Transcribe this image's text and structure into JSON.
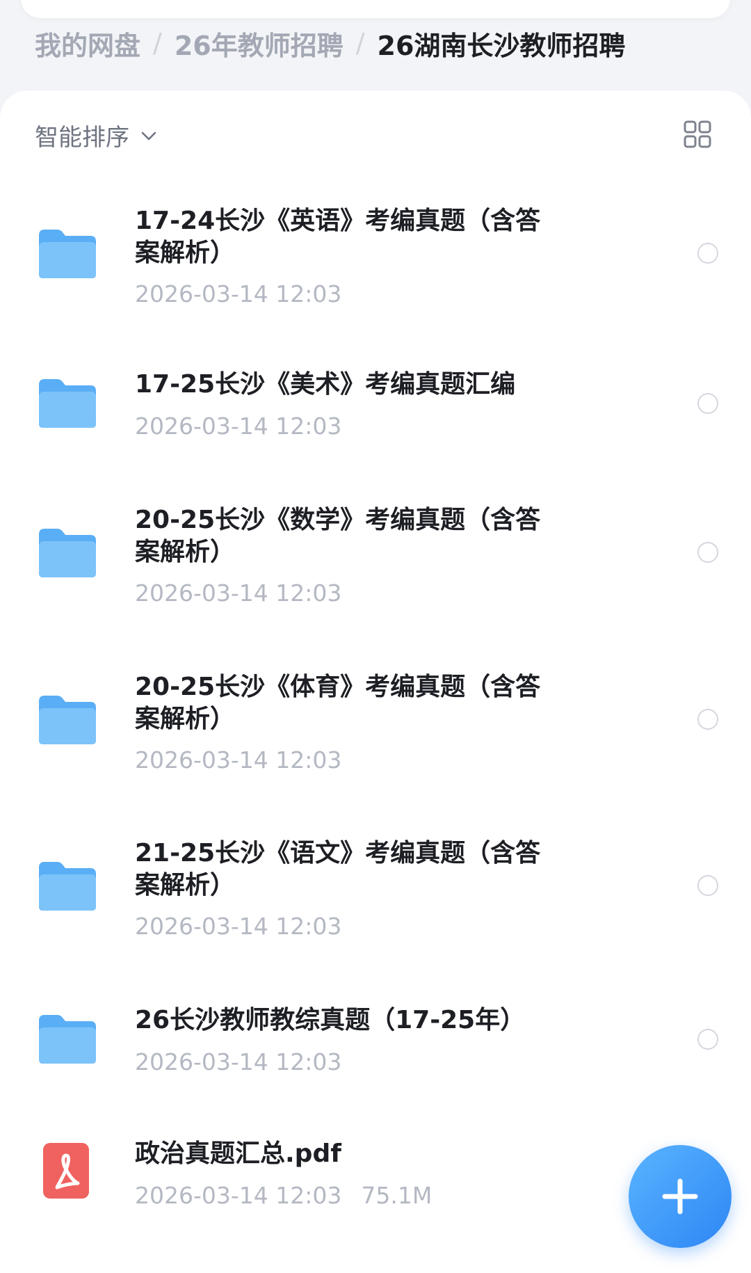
{
  "breadcrumb": [
    {
      "label": "我的网盘"
    },
    {
      "label": "26年教师招聘"
    },
    {
      "label": "26湖南长沙教师招聘"
    }
  ],
  "breadcrumb_separator": "/",
  "toolbar": {
    "sort_label": "智能排序",
    "sort_chevron_icon": "chevron-down-icon",
    "view_toggle_icon": "grid-view-icon"
  },
  "files": [
    {
      "type": "folder",
      "icon": "folder-icon",
      "name": "17-24长沙《英语》考编真题（含答案解析）",
      "date": "2026-03-14 12:03",
      "size": ""
    },
    {
      "type": "folder",
      "icon": "folder-icon",
      "name": "17-25长沙《美术》考编真题汇编",
      "date": "2026-03-14 12:03",
      "size": ""
    },
    {
      "type": "folder",
      "icon": "folder-icon",
      "name": "20-25长沙《数学》考编真题（含答案解析）",
      "date": "2026-03-14 12:03",
      "size": ""
    },
    {
      "type": "folder",
      "icon": "folder-icon",
      "name": "20-25长沙《体育》考编真题（含答案解析）",
      "date": "2026-03-14 12:03",
      "size": ""
    },
    {
      "type": "folder",
      "icon": "folder-icon",
      "name": "21-25长沙《语文》考编真题（含答案解析）",
      "date": "2026-03-14 12:03",
      "size": ""
    },
    {
      "type": "folder",
      "icon": "folder-icon",
      "name": "26长沙教师教综真题（17-25年）",
      "date": "2026-03-14 12:03",
      "size": ""
    },
    {
      "type": "pdf",
      "icon": "pdf-file-icon",
      "name": "政治真题汇总.pdf",
      "date": "2026-03-14 12:03",
      "size": "75.1M"
    }
  ],
  "fab": {
    "icon": "plus-icon"
  },
  "colors": {
    "folder": "#5aaef5",
    "pdf": "#f0625f",
    "accent": "#2d86f4",
    "title_text": "#1d1f24",
    "meta_text": "#b4b8c2"
  }
}
